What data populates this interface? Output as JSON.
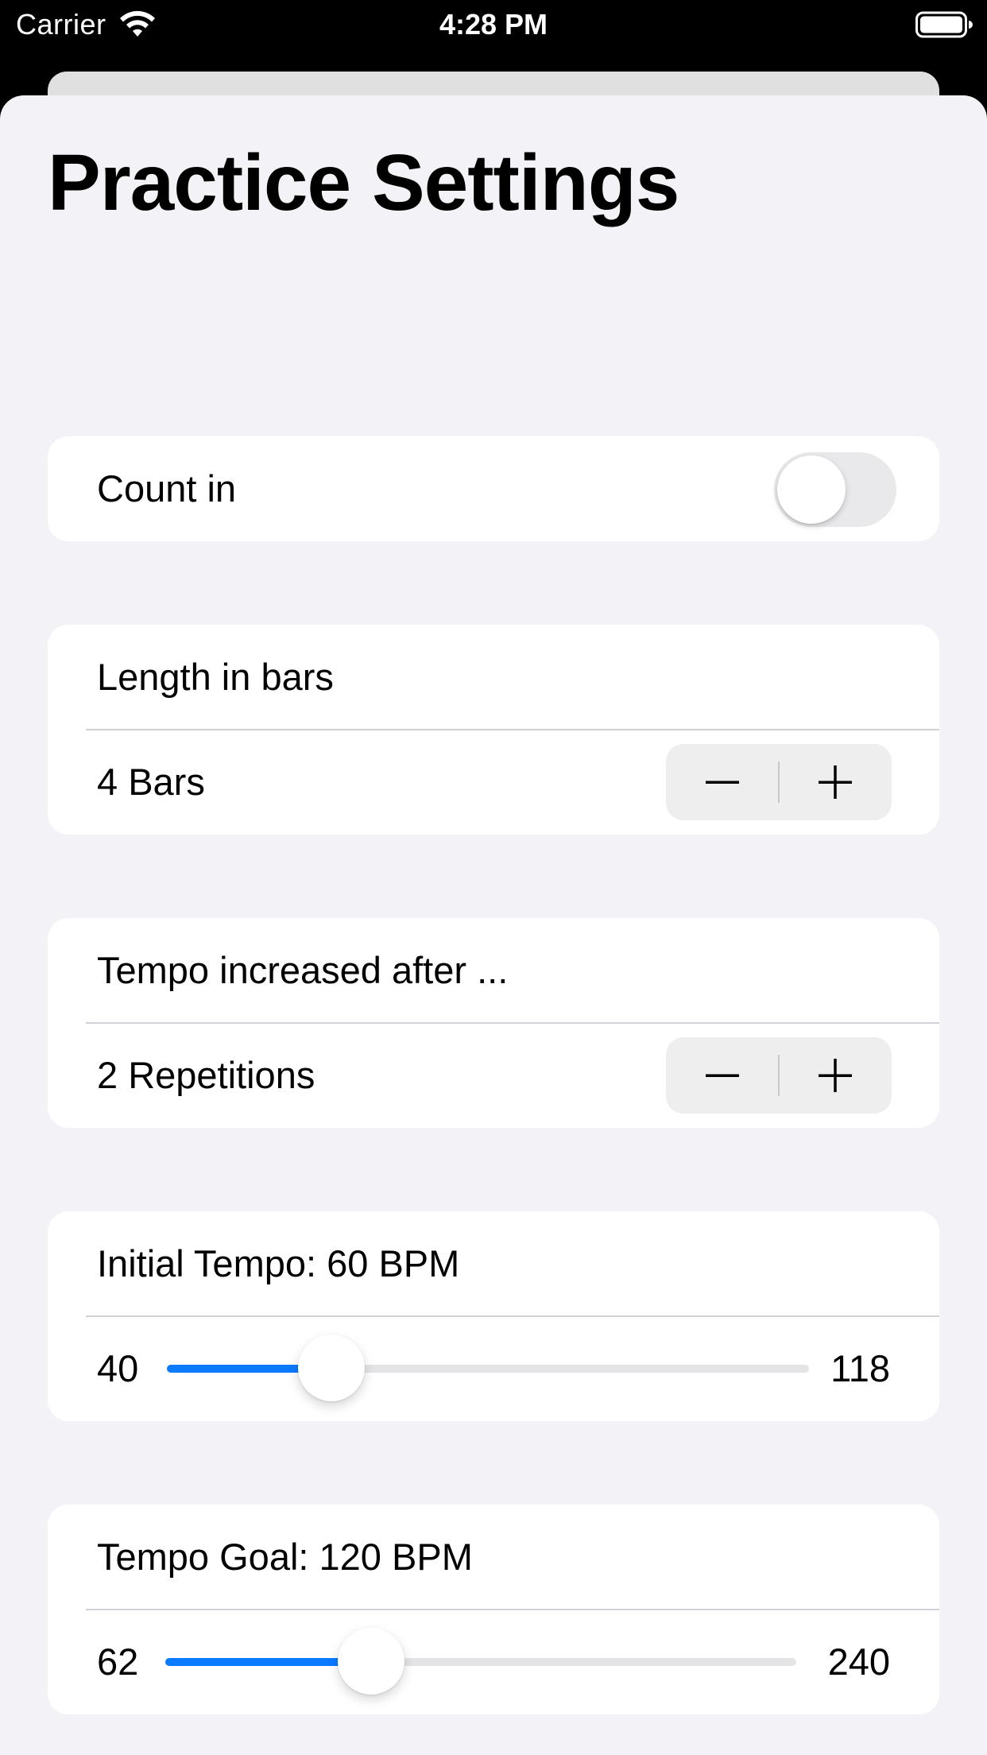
{
  "status_bar": {
    "carrier": "Carrier",
    "time": "4:28 PM",
    "wifi_icon": "wifi-icon",
    "battery_icon": "battery-icon"
  },
  "page": {
    "title": "Practice Settings"
  },
  "count_in": {
    "label": "Count in",
    "enabled": false
  },
  "length": {
    "header": "Length in bars",
    "value": "4 Bars",
    "minus_icon": "minus-icon",
    "plus_icon": "plus-icon"
  },
  "tempo_increase": {
    "header": "Tempo increased after ...",
    "value": "2 Repetitions",
    "minus_icon": "minus-icon",
    "plus_icon": "plus-icon"
  },
  "initial_tempo": {
    "header": "Initial Tempo: 60 BPM",
    "min_label": "40",
    "max_label": "118",
    "min": 40,
    "max": 118,
    "value": 60
  },
  "tempo_goal": {
    "header": "Tempo Goal: 120 BPM",
    "min_label": "62",
    "max_label": "240",
    "min": 62,
    "max": 240,
    "value": 120
  },
  "colors": {
    "accent": "#0a7aff",
    "background": "#f2f2f7",
    "card": "#ffffff",
    "toggle_off": "#e9e9eb"
  }
}
